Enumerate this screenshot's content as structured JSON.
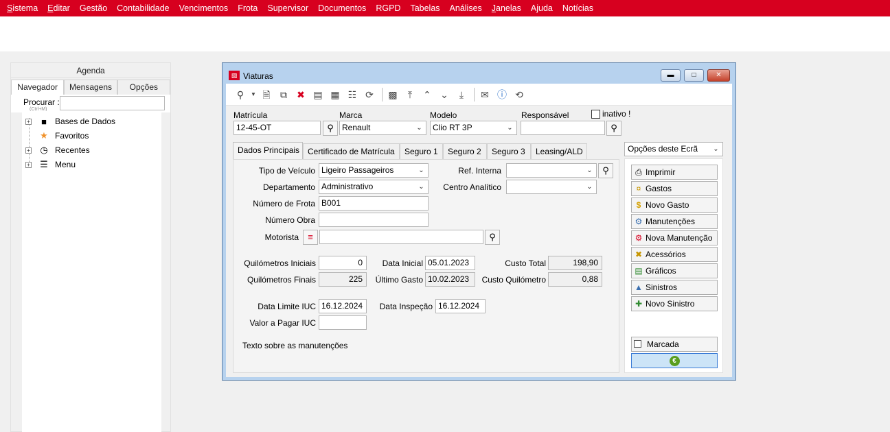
{
  "menu": [
    {
      "pre": "",
      "u": "S",
      "post": "istema"
    },
    {
      "pre": "",
      "u": "E",
      "post": "ditar"
    },
    {
      "pre": "Gestão",
      "u": "",
      "post": ""
    },
    {
      "pre": "Contabilidade",
      "u": "",
      "post": ""
    },
    {
      "pre": "Vencimentos",
      "u": "",
      "post": ""
    },
    {
      "pre": "Frota",
      "u": "",
      "post": ""
    },
    {
      "pre": "Supervisor",
      "u": "",
      "post": ""
    },
    {
      "pre": "Documentos",
      "u": "",
      "post": ""
    },
    {
      "pre": "RGPD",
      "u": "",
      "post": ""
    },
    {
      "pre": "Tabelas",
      "u": "",
      "post": ""
    },
    {
      "pre": "Análises",
      "u": "",
      "post": ""
    },
    {
      "pre": "",
      "u": "J",
      "post": "anelas"
    },
    {
      "pre": "Ajuda",
      "u": "",
      "post": ""
    },
    {
      "pre": "Notícias",
      "u": "",
      "post": ""
    }
  ],
  "left": {
    "agenda": "Agenda",
    "tabs": [
      "Navegador",
      "Mensagens",
      "Opções"
    ],
    "search_label": "Procurar :",
    "search_hint": "(Ctrl+M)",
    "tree": [
      "Bases de Dados",
      "Favoritos",
      "Recentes",
      "Menu"
    ]
  },
  "window": {
    "title": "Viaturas",
    "header": {
      "matricula_label": "Matrícula",
      "matricula": "12-45-OT",
      "marca_label": "Marca",
      "marca": "Renault",
      "modelo_label": "Modelo",
      "modelo": "Clio RT 3P",
      "responsavel_label": "Responsável",
      "responsavel": "",
      "inativo_label": "inativo !"
    },
    "tabs": [
      "Dados Principais",
      "Certificado de Matrícula",
      "Seguro 1",
      "Seguro 2",
      "Seguro 3",
      "Leasing/ALD"
    ],
    "form": {
      "tipo_label": "Tipo de Veículo",
      "tipo": "Ligeiro Passageiros",
      "dep_label": "Departamento",
      "dep": "Administrativo",
      "frota_label": "Número de Frota",
      "frota": "B001",
      "obra_label": "Número Obra",
      "obra": "",
      "motorista_label": "Motorista",
      "motorista": "",
      "refint_label": "Ref. Interna",
      "refint": "",
      "centro_label": "Centro Analítico",
      "centro": "",
      "kmini_label": "Quilómetros Iniciais",
      "kmini": "0",
      "kmfin_label": "Quilómetros Finais",
      "kmfin": "225",
      "dataini_label": "Data Inicial",
      "dataini": "05.01.2023",
      "ultgasto_label": "Último Gasto",
      "ultgasto": "10.02.2023",
      "custotot_label": "Custo Total",
      "custotot": "198,90",
      "custokm_label": "Custo Quilómetro",
      "custokm": "0,88",
      "iuc_label": "Data Limite IUC",
      "iuc": "16.12.2024",
      "inspecao_label": "Data Inspeção",
      "inspecao": "16.12.2024",
      "valoriuc_label": "Valor a Pagar IUC",
      "valoriuc": "",
      "texto_label": "Texto sobre as manutenções"
    },
    "options": {
      "select": "Opções deste Ecrã",
      "buttons": [
        "Imprimir",
        "Gastos",
        "Novo Gasto",
        "Manutenções",
        "Nova Manutenção",
        "Acessórios",
        "Gráficos",
        "Sinistros",
        "Novo Sinistro"
      ],
      "marcada_label": "Marcada"
    }
  }
}
